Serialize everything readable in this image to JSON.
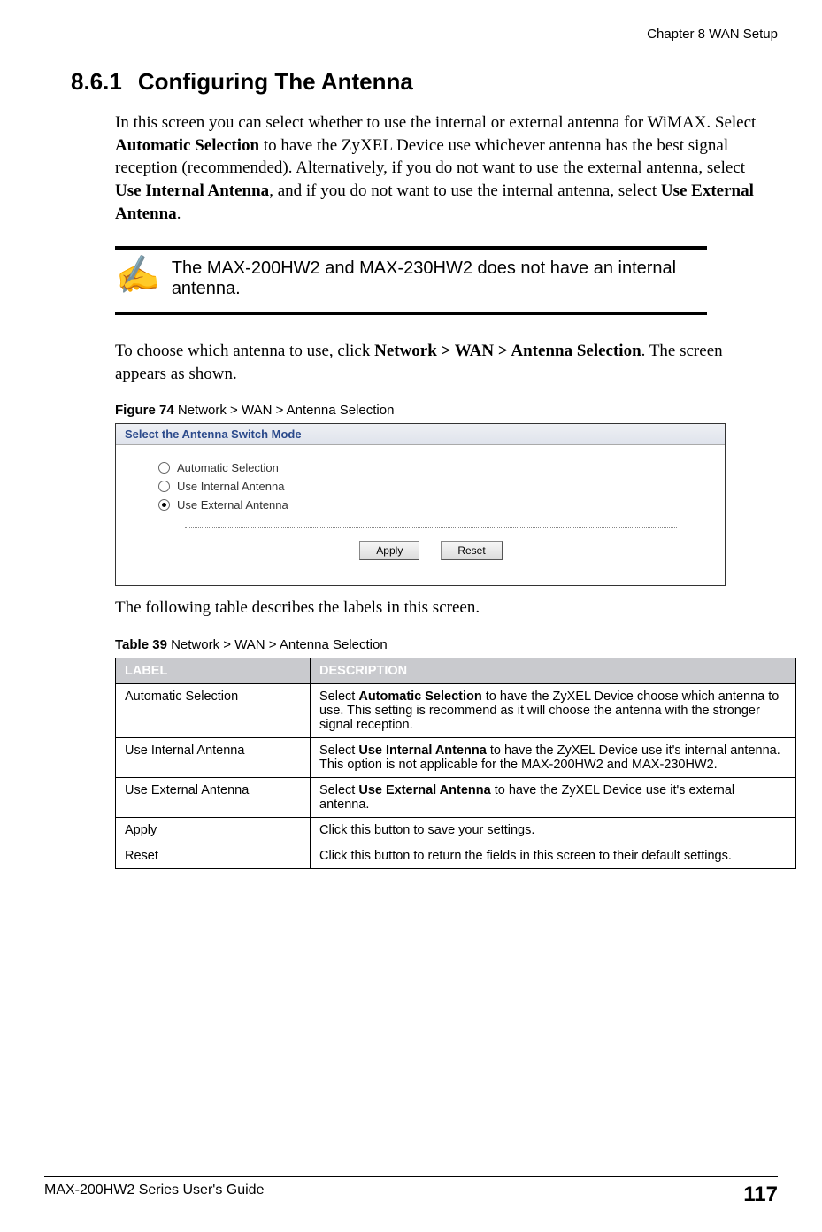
{
  "header": {
    "chapter": "Chapter 8 WAN Setup"
  },
  "section": {
    "number": "8.6.1",
    "title": "Configuring The Antenna"
  },
  "paragraphs": {
    "intro_pre": "In this screen you can select whether to use the internal or external antenna for WiMAX. Select ",
    "intro_b1": "Automatic Selection",
    "intro_mid1": " to have the ZyXEL Device use whichever antenna has the best signal reception (recommended). Alternatively, if you do not want to use the external antenna, select ",
    "intro_b2": "Use Internal Antenna",
    "intro_mid2": ", and if you do not want to use the internal antenna, select ",
    "intro_b3": "Use External Antenna",
    "intro_post": ".",
    "nav_pre": "To choose which antenna to use, click ",
    "nav_b": "Network > WAN > Antenna Selection",
    "nav_post": ". The screen appears as shown.",
    "table_intro": "The following table describes the labels in this screen."
  },
  "note": {
    "text": "The MAX-200HW2 and MAX-230HW2 does not have an internal antenna.",
    "icon": "✍"
  },
  "figure": {
    "caption_bold": "Figure 74",
    "caption_rest": "   Network > WAN > Antenna Selection",
    "panel_title": "Select the Antenna Switch Mode",
    "options": [
      {
        "label": "Automatic Selection",
        "selected": false
      },
      {
        "label": "Use Internal Antenna",
        "selected": false
      },
      {
        "label": "Use External Antenna",
        "selected": true
      }
    ],
    "buttons": {
      "apply": "Apply",
      "reset": "Reset"
    }
  },
  "table": {
    "caption_bold": "Table 39",
    "caption_rest": "   Network > WAN > Antenna Selection",
    "headers": {
      "label": "LABEL",
      "description": "DESCRIPTION"
    },
    "rows": [
      {
        "label": "Automatic Selection",
        "desc_pre": "Select ",
        "desc_b": "Automatic Selection",
        "desc_post": " to have the ZyXEL Device choose which antenna to use. This setting is recommend as it will choose the antenna with the stronger signal reception."
      },
      {
        "label": "Use Internal Antenna",
        "desc_pre": "Select ",
        "desc_b": "Use Internal Antenna",
        "desc_post": " to have the ZyXEL Device use it's internal antenna. This option is not applicable for the MAX-200HW2 and MAX-230HW2."
      },
      {
        "label": "Use External Antenna",
        "desc_pre": "Select ",
        "desc_b": "Use External Antenna",
        "desc_post": " to have the ZyXEL Device use it's external antenna."
      },
      {
        "label": "Apply",
        "desc_pre": "",
        "desc_b": "",
        "desc_post": "Click this button to save your settings."
      },
      {
        "label": "Reset",
        "desc_pre": "",
        "desc_b": "",
        "desc_post": "Click this button to return the fields in this screen to their default settings."
      }
    ]
  },
  "footer": {
    "guide": "MAX-200HW2 Series User's Guide",
    "page": "117"
  }
}
